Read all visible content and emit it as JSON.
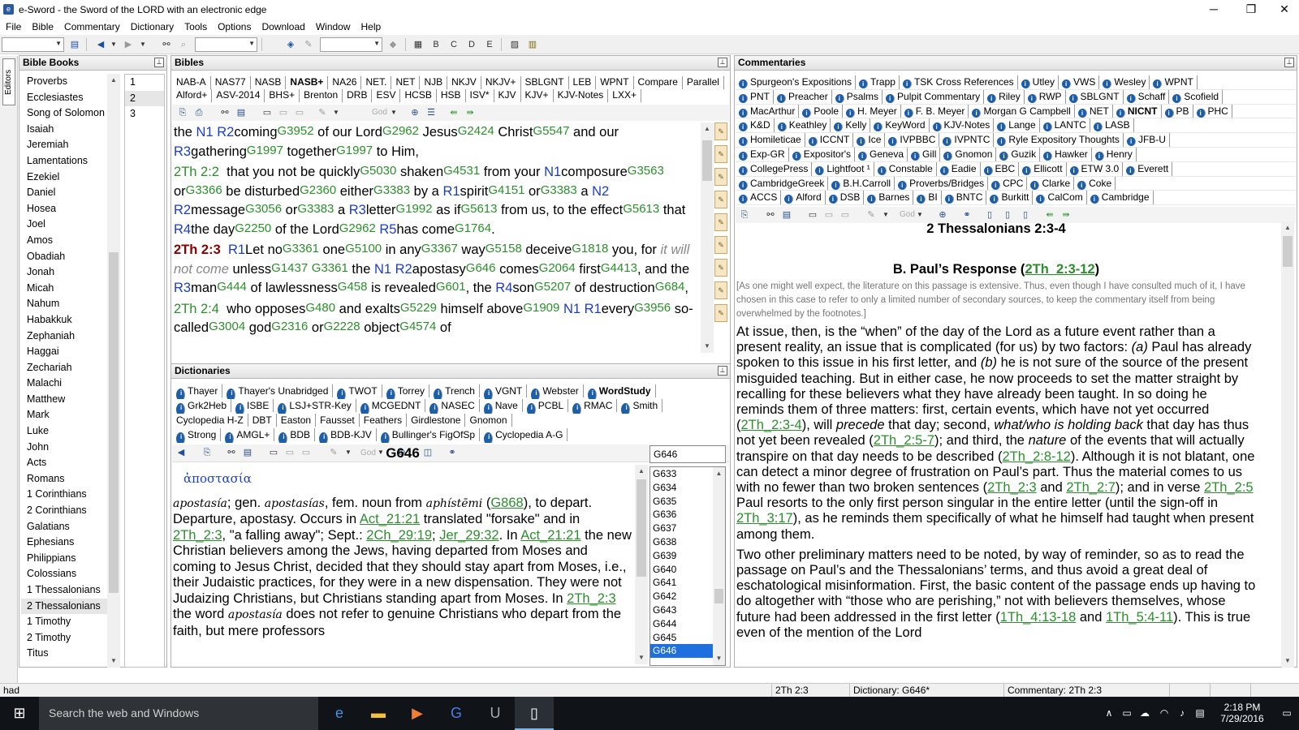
{
  "window": {
    "title": "e-Sword - the Sword of the LORD with an electronic edge",
    "minimize": "─",
    "maximize": "❐",
    "close": "✕"
  },
  "menu": [
    "File",
    "Bible",
    "Commentary",
    "Dictionary",
    "Tools",
    "Options",
    "Download",
    "Window",
    "Help"
  ],
  "editors_label": "Editors",
  "bible_books": {
    "title": "Bible Books",
    "books": [
      "Proverbs",
      "Ecclesiastes",
      "Song of Solomon",
      "Isaiah",
      "Jeremiah",
      "Lamentations",
      "Ezekiel",
      "Daniel",
      "Hosea",
      "Joel",
      "Amos",
      "Obadiah",
      "Jonah",
      "Micah",
      "Nahum",
      "Habakkuk",
      "Zephaniah",
      "Haggai",
      "Zechariah",
      "Malachi",
      "Matthew",
      "Mark",
      "Luke",
      "John",
      "Acts",
      "Romans",
      "1 Corinthians",
      "2 Corinthians",
      "Galatians",
      "Ephesians",
      "Philippians",
      "Colossians",
      "1 Thessalonians",
      "2 Thessalonians",
      "1 Timothy",
      "2 Timothy",
      "Titus"
    ],
    "selected_book": "2 Thessalonians",
    "chapters": [
      "1",
      "2",
      "3"
    ],
    "selected_chapter": "2"
  },
  "bibles": {
    "title": "Bibles",
    "tabs_row1": [
      "NAB-A",
      "NAS77",
      "NASB",
      "NASB+",
      "NA26",
      "NET.",
      "NET",
      "NJB",
      "NKJV",
      "NKJV+",
      "SBLGNT",
      "LEB",
      "WPNT",
      "Compare",
      "Parallel"
    ],
    "active_tab": "NASB+",
    "tabs_row2": [
      "Alford+",
      "ASV-2014",
      "BHS+",
      "Brenton",
      "DRB",
      "ESV",
      "HCSB",
      "HSB",
      "ISV*",
      "KJV",
      "KJV+",
      "KJV-Notes",
      "LXX+"
    ],
    "god_label": "God"
  },
  "dictionaries": {
    "title": "Dictionaries",
    "tabs_row1": [
      "Thayer",
      "Thayer's Unabridged",
      "TWOT",
      "Torrey",
      "Trench",
      "VGNT",
      "Webster",
      "WordStudy"
    ],
    "active_tab": "WordStudy",
    "tabs_row2": [
      "Grk2Heb",
      "ISBE",
      "LSJ+STR-Key",
      "MCGEDNT",
      "NASEC",
      "Nave",
      "PCBL",
      "RMAC",
      "Smith"
    ],
    "tabs_row3": [
      "Cyclopedia H-Z",
      "DBT",
      "Easton",
      "Fausset",
      "Feathers",
      "Girdlestone",
      "Gnomon"
    ],
    "tabs_row4": [
      "Strong",
      "AMGL+",
      "BDB",
      "BDB-KJV",
      "Bullinger's FigOfSp",
      "Cyclopedia A-G"
    ],
    "god_label": "God",
    "entry_title": "G646",
    "greek": "ἀποστασία",
    "search_value": "G646",
    "list": [
      "G633",
      "G634",
      "G635",
      "G636",
      "G637",
      "G638",
      "G639",
      "G640",
      "G641",
      "G642",
      "G643",
      "G644",
      "G645",
      "G646"
    ],
    "selected_item": "G646"
  },
  "commentaries": {
    "title": "Commentaries",
    "rows": [
      [
        "Spurgeon's Expositions",
        "Trapp",
        "TSK Cross References",
        "Utley",
        "VWS",
        "Wesley",
        "WPNT"
      ],
      [
        "PNT",
        "Preacher",
        "Psalms",
        "Pulpit Commentary",
        "Riley",
        "RWP",
        "SBLGNT",
        "Schaff",
        "Scofield"
      ],
      [
        "MacArthur",
        "Poole",
        "H. Meyer",
        "F. B. Meyer",
        "Morgan G Campbell",
        "NET",
        "NICNT",
        "PB",
        "PHC"
      ],
      [
        "K&D",
        "Keathley",
        "Kelly",
        "KeyWord",
        "KJV-Notes",
        "Lange",
        "LANTC",
        "LASB"
      ],
      [
        "Homileticae",
        "ICCNT",
        "Ice",
        "IVPBBC",
        "IVPNTC",
        "Ryle Expository Thoughts",
        "JFB-U"
      ],
      [
        "Exp-GR",
        "Expositor's",
        "Geneva",
        "Gill",
        "Gnomon",
        "Guzik",
        "Hawker",
        "Henry"
      ],
      [
        "CollegePress",
        "Lightfoot ¹",
        "Constable",
        "Eadie",
        "EBC",
        "Ellicott",
        "ETW 3.0",
        "Everett"
      ],
      [
        "CambridgeGreek",
        "B.H.Carroll",
        "Proverbs/Bridges",
        "CPC",
        "Clarke",
        "Coke"
      ],
      [
        "ACCS",
        "Alford",
        "DSB",
        "Barnes",
        "BI",
        "BNTC",
        "Burkitt",
        "CalCom",
        "Cambridge"
      ]
    ],
    "active_tab": "NICNT",
    "god_label": "God",
    "heading": "2 Thessalonians 2:3-4",
    "subheading": "B. Paul’s Response (",
    "subheading_link": "2Th_2:3-12",
    "subheading_end": ")",
    "note": "[As one might well expect, the literature on this passage is extensive. Thus, even though I have consulted much of it, I have chosen in this case to refer to only a limited number of secondary sources, to keep the commentary itself from being overwhelmed by the footnotes.]"
  },
  "status": {
    "left": "had",
    "ref": "2Th 2:3",
    "dict": "Dictionary: G646*",
    "comm": "Commentary: 2Th 2:3"
  },
  "taskbar": {
    "search": "Search the web and Windows",
    "time": "2:18 PM",
    "date": "7/29/2016"
  }
}
